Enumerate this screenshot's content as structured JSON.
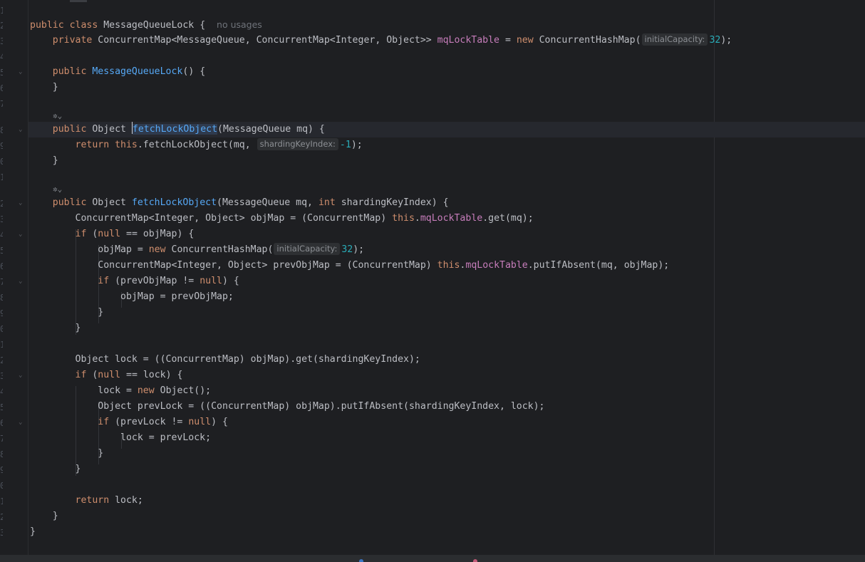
{
  "editor": {
    "lines": {
      "l1_a": "public class ",
      "l1_b": "MessageQueueLock",
      "l1_c": " {",
      "l1_usage": "no usages",
      "l2_a": "    private ",
      "l2_b": "ConcurrentMap<MessageQueue, ConcurrentMap<Integer, Object>> ",
      "l2_c": "mqLockTable",
      "l2_d": " = ",
      "l2_e": "new ",
      "l2_f": "ConcurrentHashMap(",
      "l2_hint": "initialCapacity:",
      "l2_g": "32",
      "l2_h": ");",
      "l4_a": "    public ",
      "l4_b": "MessageQueueLock",
      "l4_c": "() {",
      "l5": "    }",
      "l8_a": "    public ",
      "l8_b": "Object ",
      "l8_c": "fetchLockObject",
      "l8_d": "(MessageQueue mq) {",
      "l9_a": "        return this",
      "l9_b": ".fetchLockObject(mq, ",
      "l9_hint": "shardingKeyIndex:",
      "l9_c": "-1",
      "l9_d": ");",
      "l10": "    }",
      "l12_a": "    public ",
      "l12_b": "Object ",
      "l12_c": "fetchLockObject",
      "l12_d": "(MessageQueue mq, ",
      "l12_e": "int ",
      "l12_f": "shardingKeyIndex) {",
      "l13_a": "        ConcurrentMap<Integer, Object> objMap = (ConcurrentMap) ",
      "l13_b": "this",
      "l13_c": ".",
      "l13_d": "mqLockTable",
      "l13_e": ".get(mq);",
      "l14_a": "        if ",
      "l14_b": "(",
      "l14_c": "null",
      "l14_d": " == objMap) {",
      "l15_a": "            objMap = ",
      "l15_b": "new ",
      "l15_c": "ConcurrentHashMap(",
      "l15_hint": "initialCapacity:",
      "l15_d": "32",
      "l15_e": ");",
      "l16_a": "            ConcurrentMap<Integer, Object> prevObjMap = (ConcurrentMap) ",
      "l16_b": "this",
      "l16_c": ".",
      "l16_d": "mqLockTable",
      "l16_e": ".putIfAbsent(mq, objMap);",
      "l17_a": "            if ",
      "l17_b": "(prevObjMap != ",
      "l17_c": "null",
      "l17_d": ") {",
      "l18": "                objMap = prevObjMap;",
      "l19": "            }",
      "l20": "        }",
      "l22": "        Object lock = ((ConcurrentMap) objMap).get(shardingKeyIndex);",
      "l23_a": "        if ",
      "l23_b": "(",
      "l23_c": "null",
      "l23_d": " == lock) {",
      "l24_a": "            lock = ",
      "l24_b": "new ",
      "l24_c": "Object();",
      "l25": "            Object prevLock = ((ConcurrentMap) objMap).putIfAbsent(shardingKeyIndex, lock);",
      "l26_a": "            if ",
      "l26_b": "(prevLock != ",
      "l26_c": "null",
      "l26_d": ") {",
      "l27": "                lock = prevLock;",
      "l28": "            }",
      "l29": "        }",
      "l31_a": "        return ",
      "l31_b": "lock;",
      "l32": "    }",
      "l33": "}"
    },
    "gutter_numbers": [
      "1",
      "2",
      "3",
      "4",
      "5",
      "6",
      "7",
      "8",
      "9",
      "0",
      "1",
      "2",
      "3",
      "4",
      "5",
      "6",
      "7",
      "8",
      "9",
      "0",
      "1",
      "2",
      "3",
      "4",
      "5",
      "6",
      "7",
      "8",
      "9",
      "0",
      "1",
      "2",
      "3"
    ],
    "fold_glyph": "⌄",
    "ai_glyph": "✲⌄"
  },
  "colors": {
    "background": "#1e1f22",
    "keyword": "#cf8e6d",
    "function": "#56a8f5",
    "field": "#c77dbb",
    "number": "#2aacb8",
    "text": "#bcbec4"
  }
}
